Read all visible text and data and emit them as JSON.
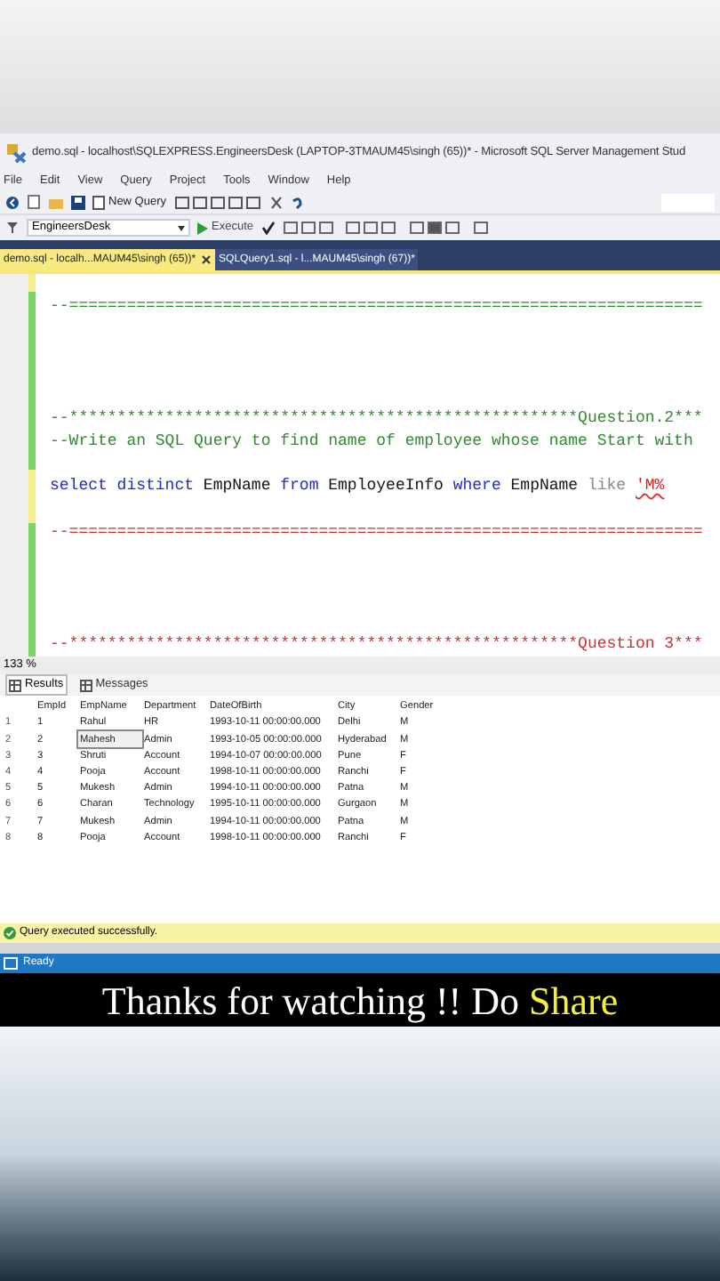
{
  "window": {
    "title": "demo.sql - localhost\\SQLEXPRESS.EngineersDesk (LAPTOP-3TMAUM45\\singh (65))* - Microsoft SQL Server Management Stud"
  },
  "menu": [
    "File",
    "Edit",
    "View",
    "Query",
    "Project",
    "Tools",
    "Window",
    "Help"
  ],
  "toolbar": {
    "new_query": "New Query",
    "database": "EngineersDesk",
    "execute": "Execute"
  },
  "doc_tabs": [
    {
      "label": "demo.sql - localh...MAUM45\\singh (65))*",
      "selected": true
    },
    {
      "label": "SQLQuery1.sql - l...MAUM45\\singh (67))*",
      "selected": false
    }
  ],
  "editor": {
    "lines": [
      {
        "kind": "blank"
      },
      {
        "kind": "code",
        "tokens": [
          {
            "kind": "comment",
            "text": "--=================================================================="
          }
        ]
      },
      {
        "kind": "blank"
      },
      {
        "kind": "blank"
      },
      {
        "kind": "blank"
      },
      {
        "kind": "blank"
      },
      {
        "kind": "code",
        "tokens": [
          {
            "kind": "comment",
            "text": "--*****************************************************Question.2***"
          }
        ]
      },
      {
        "kind": "code",
        "tokens": [
          {
            "kind": "comment",
            "text": "--Write an SQL Query to find name of employee whose name Start with"
          }
        ]
      },
      {
        "kind": "blank"
      },
      {
        "kind": "code",
        "tokens": [
          {
            "kind": "keyword",
            "text": "select distinct"
          },
          {
            "kind": "plain",
            "text": " EmpName "
          },
          {
            "kind": "keyword",
            "text": "from"
          },
          {
            "kind": "plain",
            "text": " EmployeeInfo "
          },
          {
            "kind": "keyword",
            "text": "where"
          },
          {
            "kind": "plain",
            "text": " EmpName "
          },
          {
            "kind": "operator",
            "text": "like "
          },
          {
            "kind": "string",
            "text": "'M%"
          }
        ]
      },
      {
        "kind": "blank"
      },
      {
        "kind": "code",
        "tokens": [
          {
            "kind": "error",
            "text": "--=================================================================="
          }
        ]
      },
      {
        "kind": "blank"
      },
      {
        "kind": "blank"
      },
      {
        "kind": "blank"
      },
      {
        "kind": "blank"
      },
      {
        "kind": "code",
        "tokens": [
          {
            "kind": "error",
            "text": "--*****************************************************Question 3***"
          }
        ]
      }
    ],
    "zoom": "133 %"
  },
  "result_tabs": [
    {
      "label": "Results",
      "selected": true
    },
    {
      "label": "Messages",
      "selected": false
    }
  ],
  "table": {
    "columns": [
      "EmpId",
      "EmpName",
      "Department",
      "DateOfBirth",
      "City",
      "Gender"
    ],
    "rows": [
      {
        "number": "1",
        "cells": [
          "1",
          "Rahul",
          "HR",
          "1993-10-11 00:00:00.000",
          "Delhi",
          "M"
        ],
        "selected": false
      },
      {
        "number": "2",
        "cells": [
          "2",
          "Mahesh",
          "Admin",
          "1993-10-05 00:00:00.000",
          "Hyderabad",
          "M"
        ],
        "selected": true
      },
      {
        "number": "3",
        "cells": [
          "3",
          "Shruti",
          "Account",
          "1994-10-07 00:00:00.000",
          "Pune",
          "F"
        ],
        "selected": false
      },
      {
        "number": "4",
        "cells": [
          "4",
          "Pooja",
          "Account",
          "1998-10-11 00:00:00.000",
          "Ranchi",
          "F"
        ],
        "selected": false
      },
      {
        "number": "5",
        "cells": [
          "5",
          "Mukesh",
          "Admin",
          "1994-10-11 00:00:00.000",
          "Patna",
          "M"
        ],
        "selected": false
      },
      {
        "number": "6",
        "cells": [
          "6",
          "Charan",
          "Technology",
          "1995-10-11 00:00:00.000",
          "Gurgaon",
          "M"
        ],
        "selected": false
      },
      {
        "number": "7",
        "cells": [
          "7",
          "Mukesh",
          "Admin",
          "1994-10-11 00:00:00.000",
          "Patna",
          "M"
        ],
        "selected": false
      },
      {
        "number": "8",
        "cells": [
          "8",
          "Pooja",
          "Account",
          "1998-10-11 00:00:00.000",
          "Ranchi",
          "F"
        ],
        "selected": false
      }
    ]
  },
  "query_status": "Query executed successfully.",
  "status_bar": "Ready",
  "caption": [
    {
      "text": "Thanks for watching !! Do ",
      "highlight": false
    },
    {
      "text": "Share",
      "highlight": true
    }
  ]
}
